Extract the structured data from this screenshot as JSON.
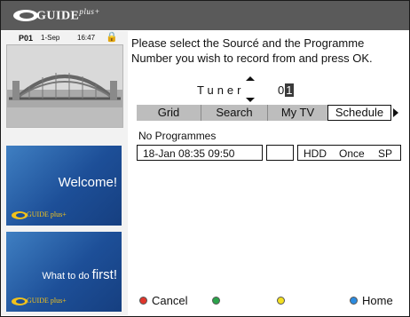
{
  "header": {
    "logo_text": "GUIDE",
    "logo_sup": "plus+"
  },
  "status": {
    "channel": "P01",
    "date": "1-Sep",
    "time": "16:47",
    "lock_icon": "lock-icon"
  },
  "preview": {
    "image": "sydney-harbour-bridge"
  },
  "ads": [
    {
      "text": "Welcome!",
      "logo": "GUIDE plus+"
    },
    {
      "text_small": "What to do",
      "text_big": "first!",
      "logo": "GUIDE plus+"
    }
  ],
  "instruction": "Please select the Sourcé and the Programme Number you wish to record from and press OK.",
  "tuner": {
    "label": "Tuner",
    "number_prefix": "0",
    "number_cursor": "1"
  },
  "tabs": [
    {
      "label": "Grid"
    },
    {
      "label": "Search"
    },
    {
      "label": "My TV"
    },
    {
      "label": "Schedule",
      "selected": true
    }
  ],
  "schedule": {
    "no_programmes": "No Programmes",
    "date_time": "18-Jan   08:35 09:50",
    "blank": "",
    "device": "HDD",
    "frequency": "Once",
    "quality": "SP"
  },
  "footer": {
    "red_label": "Cancel",
    "green_label": "",
    "yellow_label": "",
    "blue_label": "Home"
  },
  "colors": {
    "red": "#e0352b",
    "green": "#2aa34a",
    "yellow": "#f4e021",
    "blue": "#2b8be0",
    "topbar": "#5a5a5a"
  }
}
